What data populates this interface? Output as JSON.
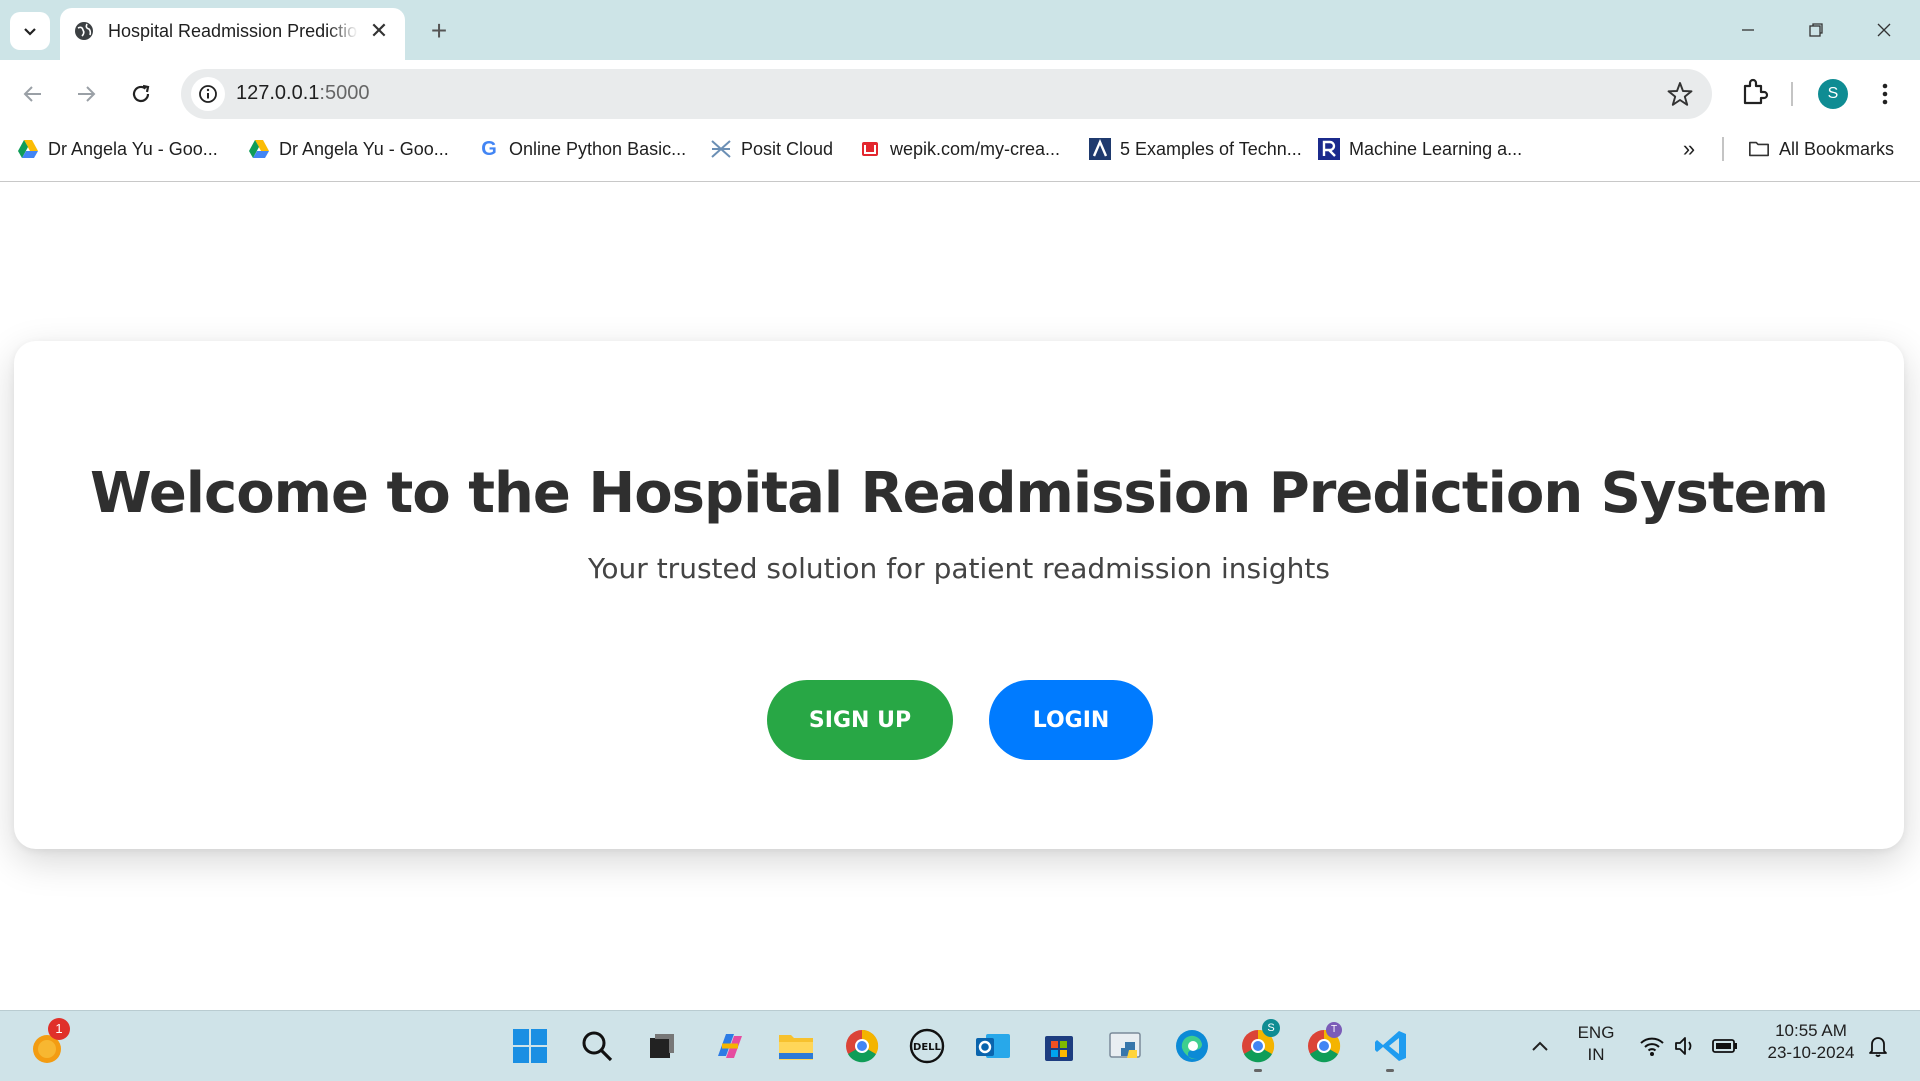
{
  "browser": {
    "tab_title": "Hospital Readmission Prediction System",
    "url_host": "127.0.0.1",
    "url_port": ":5000",
    "profile_initial": "S"
  },
  "bookmarks": [
    {
      "label": "Dr Angela Yu - Goo...",
      "icon": "google-drive-icon"
    },
    {
      "label": "Dr Angela Yu - Goo...",
      "icon": "google-drive-icon"
    },
    {
      "label": "Online Python Basic...",
      "icon": "google-g-icon"
    },
    {
      "label": "Posit Cloud",
      "icon": "posit-icon"
    },
    {
      "label": "wepik.com/my-crea...",
      "icon": "wepik-icon"
    },
    {
      "label": "5 Examples of Techn...",
      "icon": "analytics-a-icon"
    },
    {
      "label": "Machine Learning a...",
      "icon": "r-logo-icon"
    }
  ],
  "all_bookmarks_label": "All Bookmarks",
  "page": {
    "title": "Welcome to the Hospital Readmission Prediction System",
    "subtitle": "Your trusted solution for patient readmission insights",
    "signup_label": "SIGN UP",
    "login_label": "LOGIN"
  },
  "taskbar": {
    "notification_badge": "1",
    "language": "ENG",
    "region": "IN",
    "time": "10:55 AM",
    "date": "23-10-2024",
    "chrome_profile_s": "S",
    "chrome_profile_t": "T"
  },
  "colors": {
    "signup": "#28a745",
    "login": "#007bff",
    "title_text": "#2f2f2f",
    "tab_strip": "#cde4e7"
  }
}
